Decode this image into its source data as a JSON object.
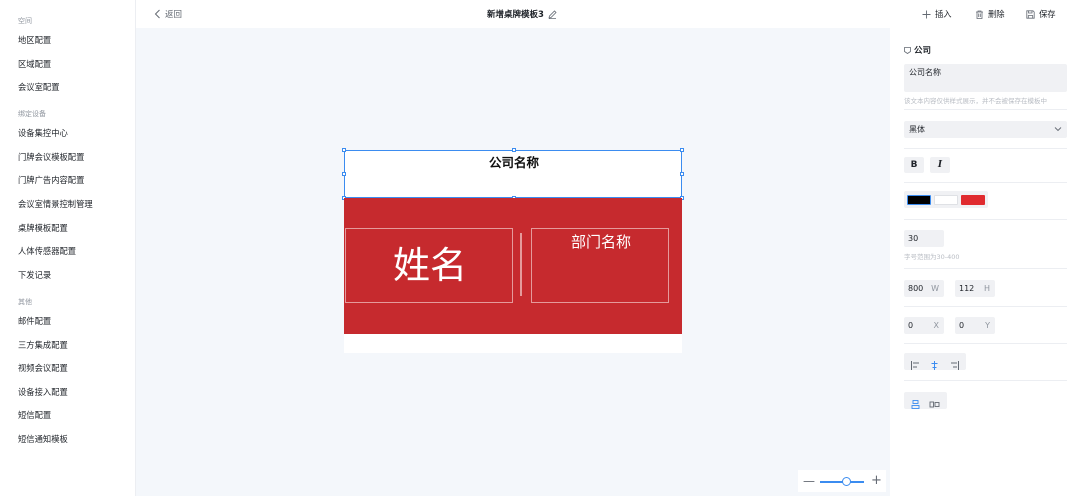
{
  "sidebar": {
    "groups": [
      {
        "label": "空间",
        "items": [
          "地区配置",
          "区域配置",
          "会议室配置"
        ]
      },
      {
        "label": "绑定设备",
        "items": [
          "设备集控中心",
          "门牌会议模板配置",
          "门牌广告内容配置",
          "会议室情景控制管理",
          "桌牌模板配置",
          "人体传感器配置",
          "下发记录"
        ]
      },
      {
        "label": "其他",
        "items": [
          "邮件配置",
          "三方集成配置",
          "视频会议配置",
          "设备接入配置",
          "短信配置",
          "短信通知模板"
        ]
      }
    ]
  },
  "topbar": {
    "back_label": "返回",
    "title": "新增桌牌模板3",
    "insert_label": "插入",
    "delete_label": "删除",
    "save_label": "保存"
  },
  "canvas": {
    "company_text": "公司名称",
    "name_text": "姓名",
    "dept_text": "部门名称",
    "zoom_level": 0.6
  },
  "panel": {
    "section_title": "公司",
    "text_value": "公司名称",
    "text_hint": "该文本内容仅供样式展示，并不会被保存在模板中",
    "font_family": "黑体",
    "bold_label": "B",
    "italic_label": "I",
    "colors": {
      "text": "#000000",
      "background": "#ffffff",
      "accent": "#e02b2f"
    },
    "font_size": "30",
    "font_size_hint": "字号范围为30-400",
    "width": "800",
    "width_unit": "W",
    "height": "112",
    "height_unit": "H",
    "x": "0",
    "x_unit": "X",
    "y": "0",
    "y_unit": "Y"
  }
}
